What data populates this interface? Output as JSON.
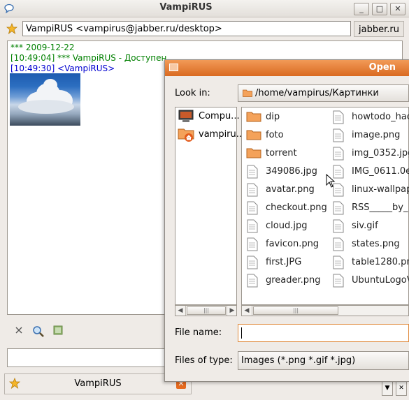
{
  "chat_window": {
    "title": "VampiRUS",
    "contact": "VampiRUS <vampirus@jabber.ru/desktop>",
    "server": "jabber.ru",
    "log": [
      {
        "text": "*** 2009-12-22",
        "kind": "system"
      },
      {
        "text": "[10:49:04] *** VampiRUS - Доступен",
        "kind": "system"
      },
      {
        "text": "[10:49:30] <VampiRUS>",
        "kind": "me"
      }
    ],
    "tab_label": "VampiRUS",
    "buttons": {
      "minimize": "_",
      "maximize": "□",
      "close": "✕"
    }
  },
  "dialog": {
    "title": "Open",
    "look_in_label": "Look in:",
    "look_in_path": "/home/vampirus/Картинки",
    "places": [
      "Compu...",
      "vampiru..."
    ],
    "files": [
      {
        "name": "dip",
        "type": "folder"
      },
      {
        "name": "foto",
        "type": "folder"
      },
      {
        "name": "torrent",
        "type": "folder"
      },
      {
        "name": "349086.jpg",
        "type": "file"
      },
      {
        "name": "avatar.png",
        "type": "file"
      },
      {
        "name": "checkout.png",
        "type": "file"
      },
      {
        "name": "cloud.jpg",
        "type": "file"
      },
      {
        "name": "favicon.png",
        "type": "file"
      },
      {
        "name": "first.JPG",
        "type": "file"
      },
      {
        "name": "greader.png",
        "type": "file"
      },
      {
        "name": "howtodo_hac",
        "type": "file"
      },
      {
        "name": "image.png",
        "type": "file"
      },
      {
        "name": "img_0352.jpg",
        "type": "file"
      },
      {
        "name": "IMG_0611.0e",
        "type": "file"
      },
      {
        "name": "linux-wallpap",
        "type": "file"
      },
      {
        "name": "RSS_____by_",
        "type": "file"
      },
      {
        "name": "siv.gif",
        "type": "file"
      },
      {
        "name": "states.png",
        "type": "file"
      },
      {
        "name": "table1280.pn",
        "type": "file"
      },
      {
        "name": "UbuntuLogoV",
        "type": "file"
      }
    ],
    "file_name_label": "File name:",
    "file_name_value": "",
    "file_type_label": "Files of type:",
    "file_type_value": "Images (*.png *.gif *.jpg)"
  },
  "colors": {
    "dialog_title_bar": "#e57d35",
    "system_text": "#008000",
    "own_text": "#0000d0"
  }
}
